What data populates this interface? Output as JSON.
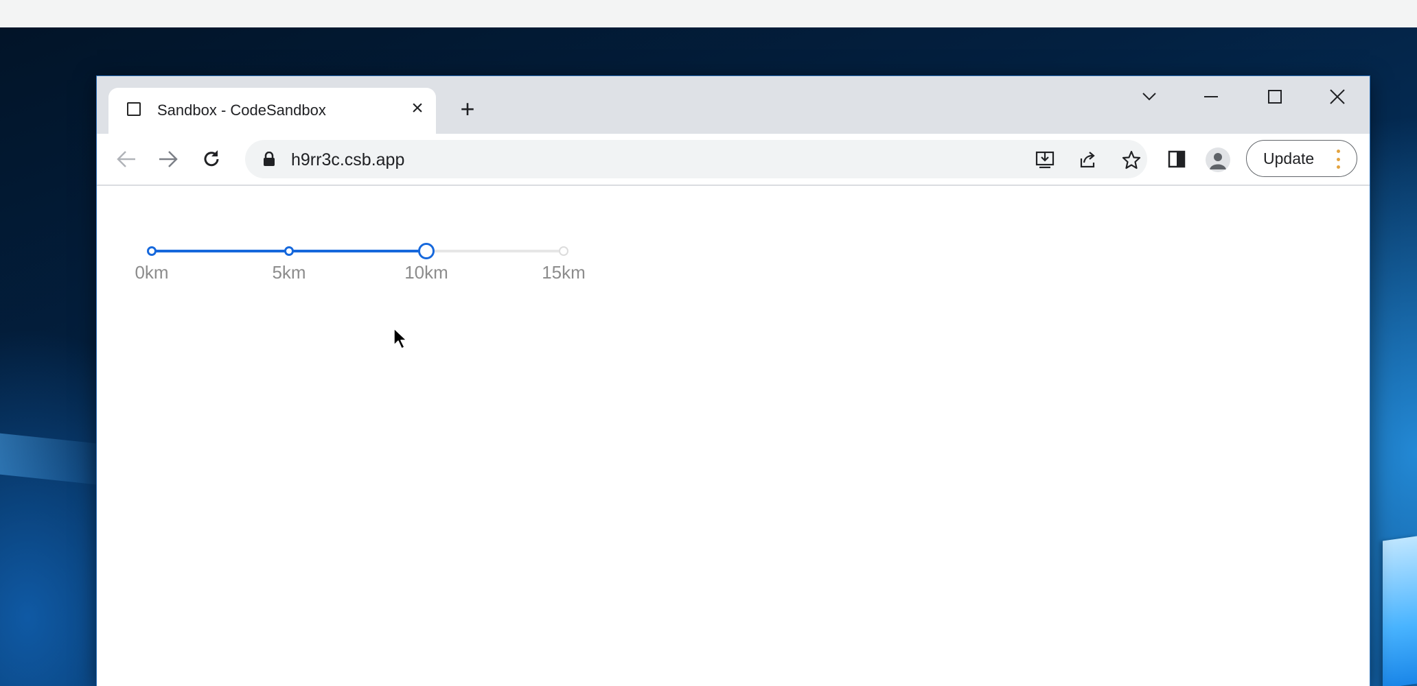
{
  "browser": {
    "tab": {
      "title": "Sandbox - CodeSandbox",
      "favicon": "square-icon"
    },
    "address_bar": {
      "url": "h9rr3c.csb.app",
      "secure_icon": "lock-icon"
    },
    "update_button": {
      "label": "Update"
    },
    "window_controls": [
      "chevron-down-icon",
      "minimize-icon",
      "maximize-icon",
      "close-icon"
    ],
    "toolbar_icons": [
      "back-arrow-icon",
      "forward-arrow-icon",
      "reload-icon",
      "install-app-icon",
      "share-icon",
      "bookmark-star-icon",
      "side-panel-icon",
      "profile-icon"
    ]
  },
  "slider": {
    "marks": [
      {
        "label": "0km",
        "value": 0
      },
      {
        "label": "5km",
        "value": 5
      },
      {
        "label": "10km",
        "value": 10
      },
      {
        "label": "15km",
        "value": 15
      }
    ],
    "min": 0,
    "max": 15,
    "value": 10,
    "accent_color": "#1668dc",
    "rail_color": "#e6e6e6"
  }
}
